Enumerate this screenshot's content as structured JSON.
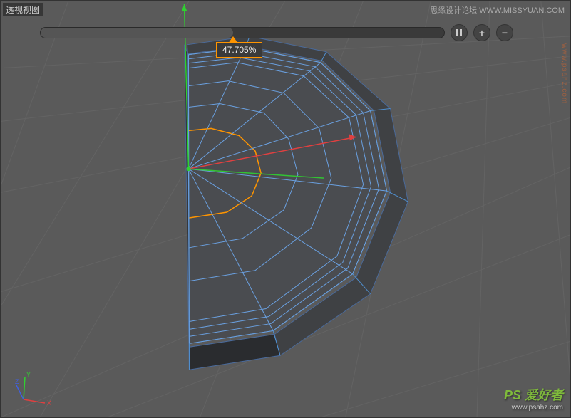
{
  "viewport": {
    "label": "透视视图"
  },
  "slider": {
    "value_text": "47.705%",
    "value": 47.705,
    "btn_pause": "||",
    "btn_plus": "+",
    "btn_minus": "−"
  },
  "watermarks": {
    "top_right": "思缘设计论坛 WWW.MISSYUAN.COM",
    "side": "www.psahz.com",
    "bottom_main": "PS 爱好者",
    "bottom_sub": "www.psahz.com"
  },
  "axis": {
    "x": "X",
    "y": "Y",
    "z": "Z"
  },
  "colors": {
    "accent": "#ff9500",
    "axis_x": "#d04040",
    "axis_y": "#40d040",
    "axis_z": "#4060d0",
    "selection": "#ff9500",
    "wireframe": "#5090d0"
  }
}
